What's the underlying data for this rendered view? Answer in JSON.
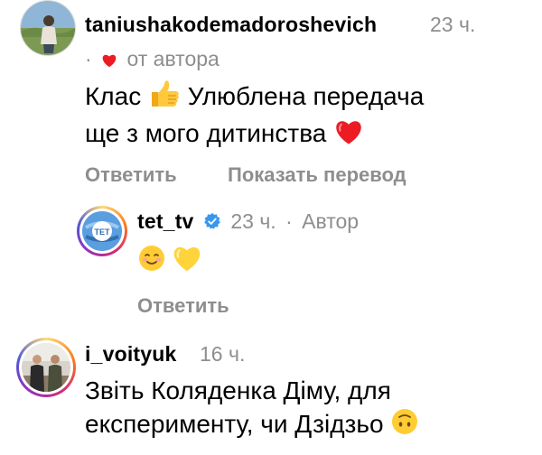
{
  "comments": [
    {
      "username": "taniushakodemadoroshevich",
      "time": "23 ч.",
      "dot": "·",
      "author_like_label": "от автора",
      "text_line1": "Клас",
      "text_line1b": "Улюблена передача",
      "text_line2": "ще з мого дитинства",
      "reply_label": "Ответить",
      "translate_label": "Показать перевод"
    },
    {
      "username": "tet_tv",
      "time": "23 ч.",
      "dot": "·",
      "author_label": "Автор",
      "avatar_text": "ТЕТ",
      "reply_label": "Ответить"
    },
    {
      "username": "i_voityuk",
      "time": "16 ч.",
      "text_line1": "Звіть Коляденка Діму, для",
      "text_line2": "експерименту, чи Дзідзьо"
    }
  ],
  "colors": {
    "heart": "#ed1c24",
    "verified": "#3897f0",
    "muted": "#8e8e8e",
    "tet_blue": "#4a8fd8"
  },
  "icons": [
    "heart-icon",
    "thumbs-up-icon",
    "red-heart-icon",
    "verified-badge-icon",
    "smiling-face-icon",
    "yellow-heart-icon",
    "upside-down-face-icon"
  ]
}
